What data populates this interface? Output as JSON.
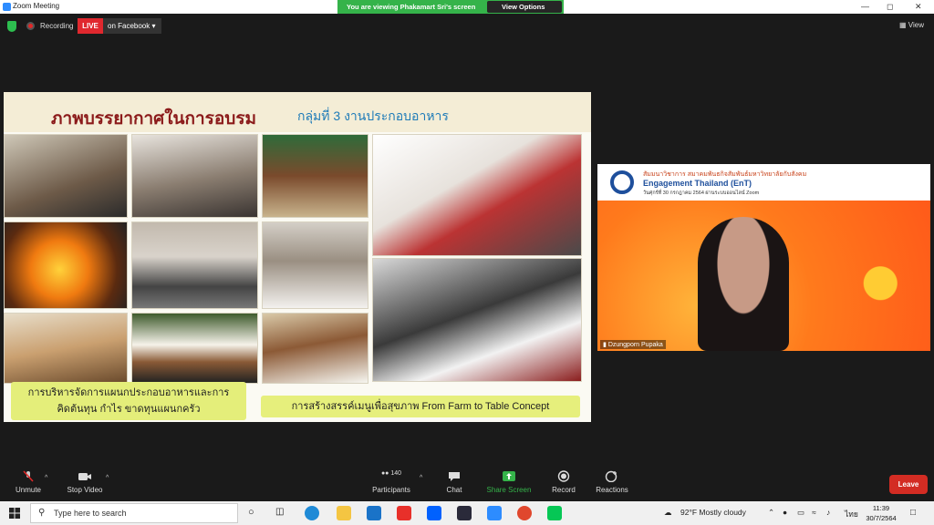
{
  "window": {
    "title": "Zoom Meeting"
  },
  "viewing": {
    "text": "You are viewing Phakamart Sri's screen",
    "view_options": "View Options"
  },
  "status": {
    "recording": "Recording",
    "live": "LIVE",
    "live_target": "on Facebook",
    "view": "View"
  },
  "slide": {
    "headline": "ภาพบรรยากาศในการอบรม",
    "subhead": "กลุ่มที่ 3 งานประกอบอาหาร",
    "caption_left_1": "การบริหารจัดการแผนกประกอบอาหารและการ",
    "caption_left_2": "คิดต้นทุน กำไร ขาดทุนแผนกครัว",
    "caption_right": "การสร้างสรรค์เมนูเพื่อสุขภาพ From Farm to Table Concept"
  },
  "speaker": {
    "banner_line1": "สัมมนาวิชาการ สมาคมพันธกิจสัมพันธ์มหาวิทยาลัยกับสังคม",
    "banner_line2": "Engagement Thailand (EnT)",
    "banner_line3": "วันศุกร์ที่ 30 กรกฎาคม 2564 ผ่านระบบออนไลน์ Zoom",
    "name": "Dzungporn Pupaka"
  },
  "toolbar": {
    "unmute": "Unmute",
    "stop_video": "Stop Video",
    "participants": "Participants",
    "participants_count": "140",
    "chat": "Chat",
    "share_screen": "Share Screen",
    "record": "Record",
    "reactions": "Reactions",
    "leave": "Leave"
  },
  "taskbar": {
    "search_placeholder": "Type here to search",
    "weather": "92°F  Mostly cloudy",
    "lang": "ไทย",
    "time": "11:39",
    "date": "30/7/2564"
  },
  "colors": {
    "zoom_blue": "#2d8cff",
    "viewing_green": "#35b34a",
    "live_red": "#e0282e",
    "share_green": "#35b34a",
    "leave_red": "#d32c23"
  }
}
